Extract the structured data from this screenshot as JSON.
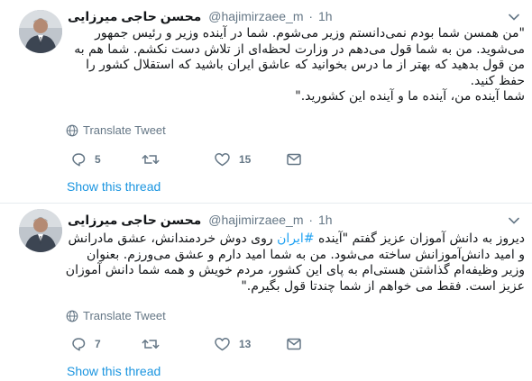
{
  "tweets": [
    {
      "name": "محسن حاجی میرزایی",
      "handle": "@hajimirzaee_m",
      "separator": "·",
      "time": "1h",
      "text": "\"من همسن شما بودم نمی‌دانستم وزیر می‌شوم. شما در آینده وزیر و رئیس جمهور می‌شوید. من به شما قول می‌دهم در وزارت لحظه‌ای از تلاش دست نکشم. شما هم به من قول بدهید که بهتر از ما درس بخوانید که عاشق ایران باشید که استقلال کشور را حفظ کنید.\nشما آینده من، آینده ما و آینده این کشورید.\"",
      "translate_label": "Translate Tweet",
      "reply_count": "5",
      "retweet_count": "",
      "like_count": "15",
      "show_thread": "Show this thread"
    },
    {
      "name": "محسن حاجی میرزایی",
      "handle": "@hajimirzaee_m",
      "separator": "·",
      "time": "1h",
      "text_before": "دیروز به دانش آموزان عزیز گفتم \"آینده ",
      "hashtag": "#ایران",
      "text_after": " روی دوش خردمندانش، عشق مادرانش و امید دانش‌آموزانش ساخته می‌شود. من به شما امید دارم و عشق می‌ورزم. بعنوان وزیر وظیفه‌ام گذاشتن هستی‌ام به پای این کشور، مردم خویش و همه شما دانش آموزان عزیز است. فقط می خواهم از شما چندتا قول بگیرم.\"",
      "translate_label": "Translate Tweet",
      "reply_count": "7",
      "retweet_count": "",
      "like_count": "13",
      "show_thread": "Show this thread"
    }
  ],
  "icons": {
    "reply": "reply-icon",
    "retweet": "retweet-icon",
    "like": "heart-icon",
    "message": "envelope-icon",
    "globe": "globe-icon",
    "caret": "chevron-down-icon"
  },
  "colors": {
    "link": "#1b95e0",
    "hashtag": "#1da1f2",
    "muted": "#657786",
    "text": "#14171a",
    "separator": "#e6ecf0"
  }
}
